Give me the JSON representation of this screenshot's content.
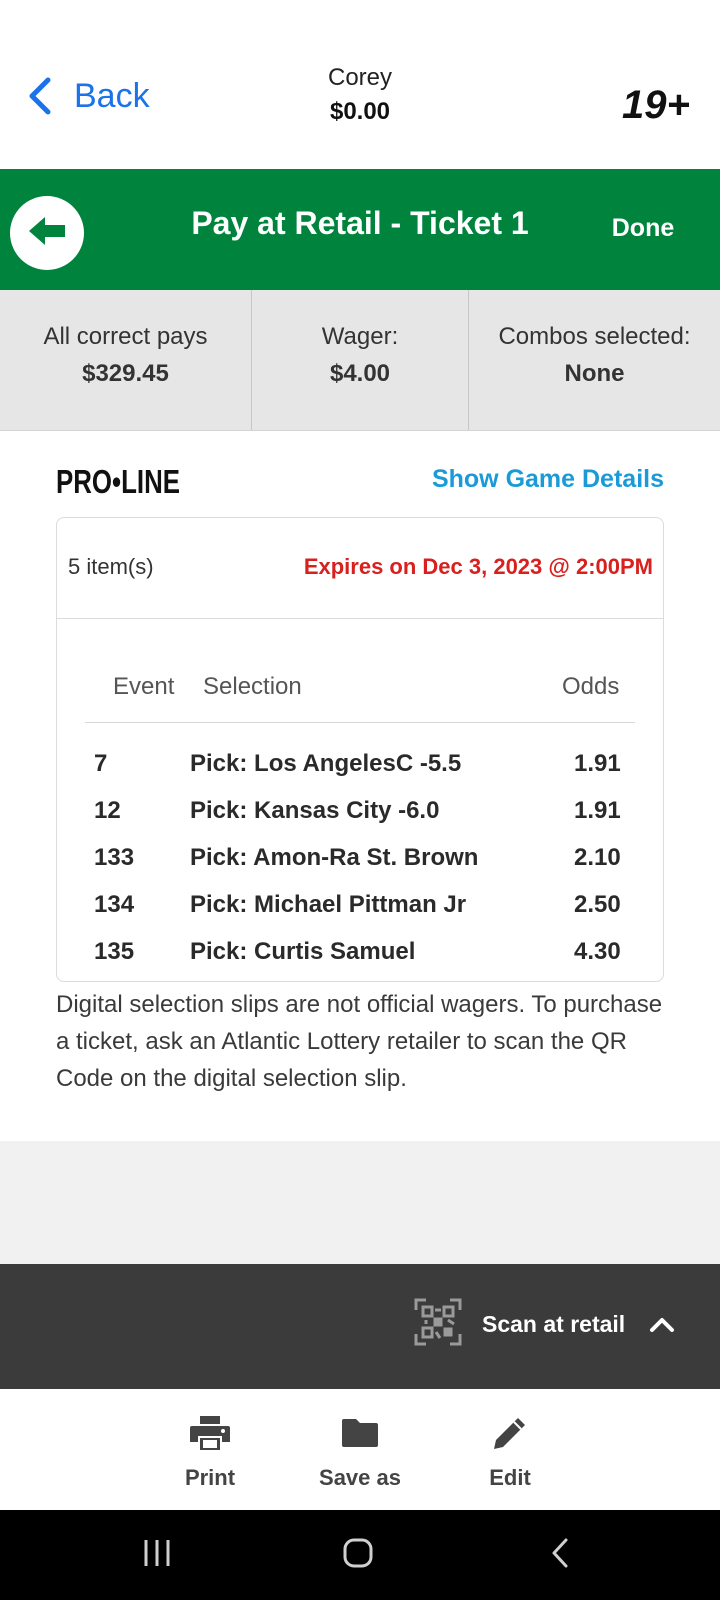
{
  "header": {
    "back_label": "Back",
    "user_name": "Corey",
    "balance": "$0.00",
    "age_badge": "19+"
  },
  "title_bar": {
    "title": "Pay at Retail - Ticket 1",
    "done_label": "Done"
  },
  "summary": {
    "pays_label": "All correct pays",
    "pays_value": "$329.45",
    "wager_label": "Wager:",
    "wager_value": "$4.00",
    "combos_label": "Combos selected:",
    "combos_value": "None"
  },
  "slip": {
    "logo_text": "PRO•LINE",
    "show_details_label": "Show Game Details",
    "items_count": "5 item(s)",
    "expires": "Expires on Dec 3, 2023 @ 2:00PM",
    "columns": {
      "event": "Event",
      "selection": "Selection",
      "odds": "Odds"
    },
    "rows": [
      {
        "event": "7",
        "selection": "Pick: Los AngelesC -5.5",
        "odds": "1.91"
      },
      {
        "event": "12",
        "selection": "Pick: Kansas City -6.0",
        "odds": "1.91"
      },
      {
        "event": "133",
        "selection": "Pick: Amon-Ra St. Brown",
        "odds": "2.10"
      },
      {
        "event": "134",
        "selection": "Pick: Michael Pittman Jr",
        "odds": "2.50"
      },
      {
        "event": "135",
        "selection": "Pick: Curtis Samuel",
        "odds": "4.30"
      }
    ],
    "disclaimer": "Digital selection slips are not official wagers. To purchase a ticket, ask an Atlantic Lottery retailer to scan the QR Code on the digital selection slip."
  },
  "scan": {
    "label": "Scan at retail"
  },
  "actions": {
    "print_label": "Print",
    "save_label": "Save as",
    "edit_label": "Edit"
  },
  "colors": {
    "brand_green": "#00843d",
    "link_blue": "#1a73e8",
    "details_blue": "#1a9bd7",
    "expires_red": "#d8201e"
  },
  "icons": {
    "back": "chevron-left-icon",
    "circle_back": "arrow-left-icon",
    "scan": "qr-code-icon",
    "scan_toggle": "chevron-up-icon",
    "print": "printer-icon",
    "save": "folder-icon",
    "edit": "pencil-icon"
  }
}
